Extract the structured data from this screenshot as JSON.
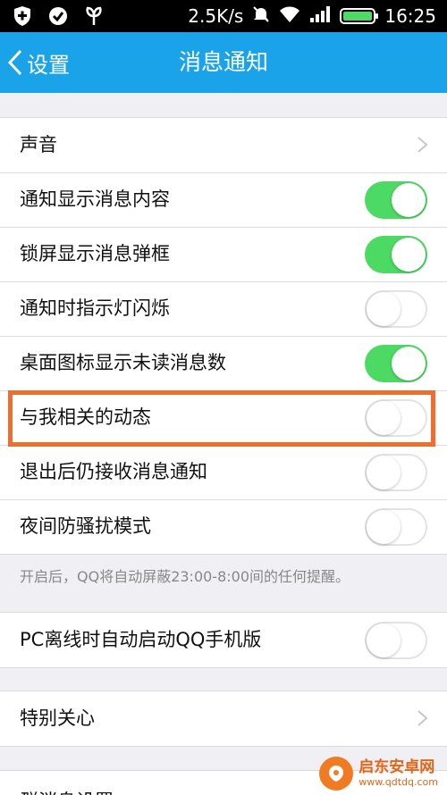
{
  "status_bar": {
    "speed": "2.5K/s",
    "time": "16:25"
  },
  "header": {
    "back_label": "设置",
    "title": "消息通知"
  },
  "settings": {
    "sound": {
      "label": "声音"
    },
    "items": [
      {
        "label": "通知显示消息内容",
        "on": true
      },
      {
        "label": "锁屏显示消息弹框",
        "on": true
      },
      {
        "label": "通知时指示灯闪烁",
        "on": false
      },
      {
        "label": "桌面图标显示未读消息数",
        "on": true
      },
      {
        "label": "与我相关的动态",
        "on": false
      },
      {
        "label": "退出后仍接收消息通知",
        "on": false
      },
      {
        "label": "夜间防骚扰模式",
        "on": false
      }
    ],
    "night_note": "开启后，QQ将自动屏蔽23:00-8:00间的任何提醒。",
    "pc_offline": {
      "label": "PC离线时自动启动QQ手机版",
      "on": false
    },
    "special_care": {
      "label": "特别关心"
    },
    "group_msg": {
      "label": "群消息设置"
    }
  },
  "watermark": {
    "name": "启东安卓网",
    "url": "www.qdtdq.com"
  },
  "colors": {
    "header_bg": "#1aa3e8",
    "toggle_on": "#4cd964",
    "highlight": "#f26c2d"
  }
}
